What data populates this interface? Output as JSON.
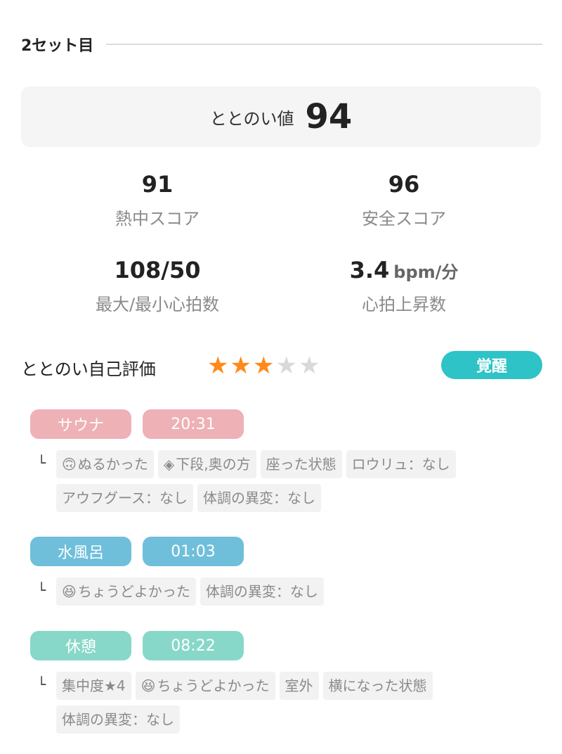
{
  "set_title": "2セット目",
  "totonoi": {
    "label": "ととのい値",
    "value": "94"
  },
  "stats": {
    "heat": {
      "value": "91",
      "label": "熱中スコア"
    },
    "safety": {
      "value": "96",
      "label": "安全スコア"
    },
    "heart_range": {
      "value": "108/50",
      "label": "最大/最小心拍数"
    },
    "heart_rise": {
      "value": "3.4",
      "unit": "bpm/分",
      "label": "心拍上昇数"
    }
  },
  "self_eval": {
    "label": "ととのい自己評価",
    "rating": 3,
    "max": 5,
    "mood": "覚醒"
  },
  "colors": {
    "sauna": "#eeb1b5",
    "mizuburo": "#6fbfdb",
    "rest": "#87d8c8",
    "star_on": "#ff8a1a",
    "star_off": "#d9d9d9",
    "mood": "#2ec3c6"
  },
  "sauna": {
    "name": "サウナ",
    "time": "20:31",
    "corner": "└",
    "tags": [
      {
        "icon": "🙃",
        "text": "ぬるかった"
      },
      {
        "icon": "◈",
        "text": "下段,奥の方"
      },
      {
        "text": "座った状態"
      },
      {
        "text": "ロウリュ：なし"
      },
      {
        "text": "アウフグース：なし"
      },
      {
        "text": "体調の異変：なし"
      }
    ]
  },
  "mizuburo": {
    "name": "水風呂",
    "time": "01:03",
    "corner": "└",
    "tags": [
      {
        "icon": "😆",
        "text": "ちょうどよかった"
      },
      {
        "text": "体調の異変：なし"
      }
    ]
  },
  "rest": {
    "name": "休憩",
    "time": "08:22",
    "corner": "└",
    "tags": [
      {
        "text": "集中度★4"
      },
      {
        "icon": "😆",
        "text": "ちょうどよかった"
      },
      {
        "text": "室外"
      },
      {
        "text": "横になった状態"
      },
      {
        "text": "体調の異変：なし"
      }
    ]
  }
}
